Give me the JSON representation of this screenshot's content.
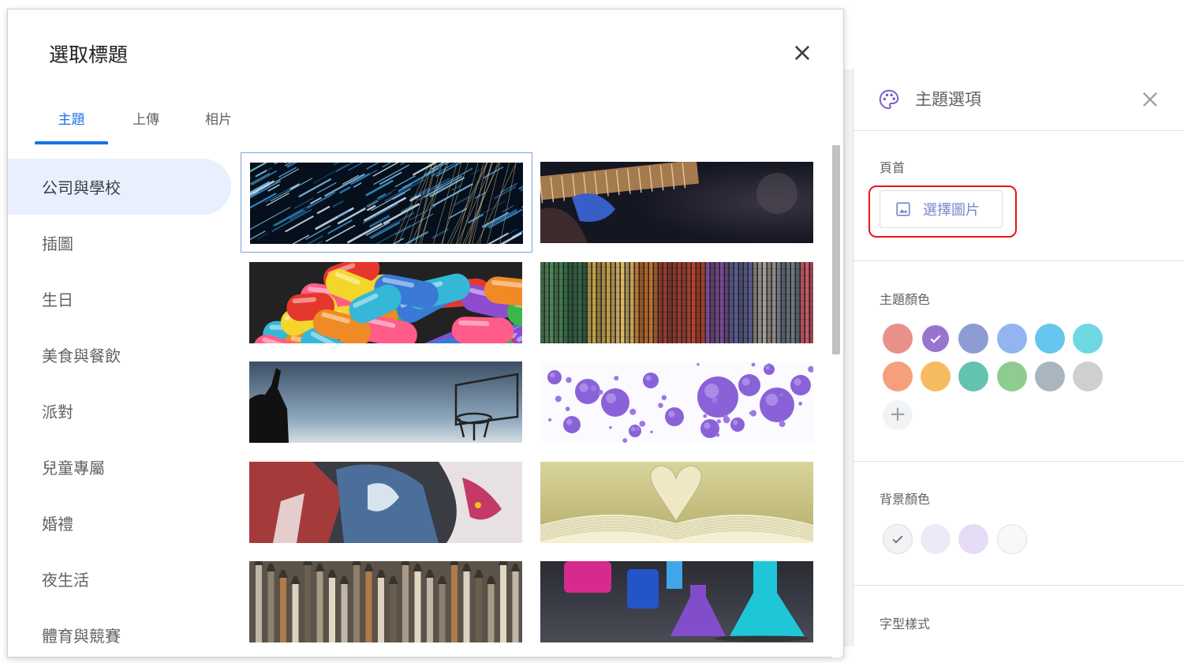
{
  "dialog": {
    "title": "選取標題",
    "tabs": [
      {
        "label": "主題",
        "active": true
      },
      {
        "label": "上傳",
        "active": false
      },
      {
        "label": "相片",
        "active": false
      }
    ],
    "categories": [
      {
        "label": "公司與學校",
        "active": true
      },
      {
        "label": "插圖",
        "active": false
      },
      {
        "label": "生日",
        "active": false
      },
      {
        "label": "美食與餐飲",
        "active": false
      },
      {
        "label": "派對",
        "active": false
      },
      {
        "label": "兒童專屬",
        "active": false
      },
      {
        "label": "婚禮",
        "active": false
      },
      {
        "label": "夜生活",
        "active": false
      },
      {
        "label": "體育與競賽",
        "active": false
      }
    ],
    "images": [
      {
        "name": "thumb-light-streaks",
        "selected": true
      },
      {
        "name": "thumb-guitar-concert",
        "selected": false
      },
      {
        "name": "thumb-candies",
        "selected": false
      },
      {
        "name": "thumb-colorful-yarn",
        "selected": false
      },
      {
        "name": "thumb-basketball",
        "selected": false
      },
      {
        "name": "thumb-purple-spheres",
        "selected": false
      },
      {
        "name": "thumb-painted-hands",
        "selected": false
      },
      {
        "name": "thumb-book-heart",
        "selected": false
      },
      {
        "name": "thumb-paint-brushes",
        "selected": false
      },
      {
        "name": "thumb-lab-flasks",
        "selected": false
      }
    ],
    "accent_color": "#1a73e8"
  },
  "theme_panel": {
    "title": "主題選項",
    "header_section_label": "頁首",
    "choose_image_label": "選擇圖片",
    "theme_color_label": "主題顏色",
    "theme_colors": [
      "#e8918b",
      "#9575cd",
      "#8e9cd4",
      "#93b4f1",
      "#66c6f0",
      "#6fd8e3",
      "#f4a07c",
      "#f7bb5f",
      "#63c3b0",
      "#8fcc8f",
      "#a9b6c0",
      "#cfcfcf"
    ],
    "selected_theme_color": "#9575cd",
    "background_color_label": "背景顏色",
    "background_colors": [
      "#f3f3f5",
      "#ede9f8",
      "#e6dcf5",
      "#f8f8f8"
    ],
    "selected_background_color": "#f3f3f5",
    "font_style_label": "字型樣式",
    "highlight_color": "#e8151b"
  }
}
